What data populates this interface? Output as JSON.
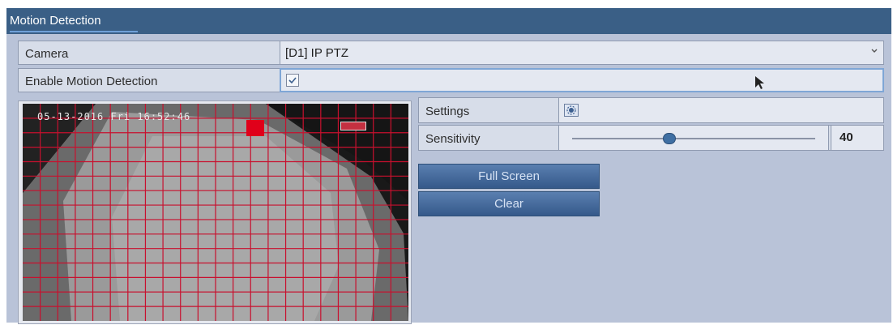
{
  "window": {
    "title": "Motion Detection"
  },
  "form": {
    "camera_label": "Camera",
    "camera_value": "[D1] IP PTZ",
    "enable_label": "Enable Motion Detection",
    "enable_checked": true
  },
  "preview": {
    "timestamp": "05-13-2016 Fri 16:52:46"
  },
  "settings": {
    "settings_label": "Settings",
    "sensitivity_label": "Sensitivity",
    "sensitivity_value": "40",
    "sensitivity_fraction": 0.4
  },
  "buttons": {
    "full_screen": "Full Screen",
    "clear": "Clear"
  },
  "icons": {
    "dropdown": "chevron-down-icon",
    "checkbox": "check-icon",
    "settings": "gear-icon",
    "cursor": "mouse-pointer-icon"
  },
  "colors": {
    "title_bar": "#3a5f86",
    "panel": "#b9c3d8",
    "grid": "#c8102e",
    "button": "#3f6395"
  }
}
